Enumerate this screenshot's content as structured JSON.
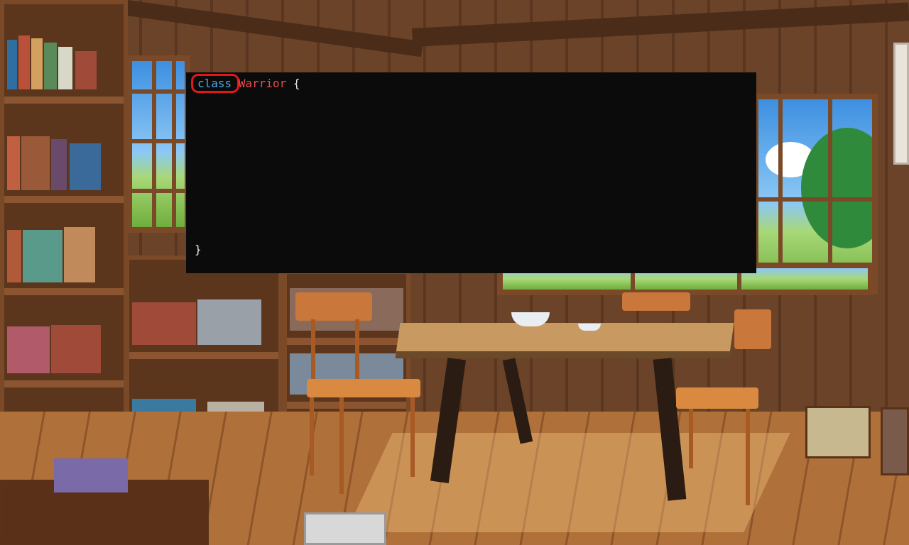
{
  "editor": {
    "line1": {
      "keyword": "class",
      "name": "Warrior",
      "open_brace": "{"
    },
    "line_last": {
      "close_brace": "}"
    },
    "highlight_color": "#e01818",
    "keyword_color": "#4fa8e8",
    "classname_color": "#e84a4a"
  },
  "scene": {
    "description_icon": "library-room-background"
  }
}
